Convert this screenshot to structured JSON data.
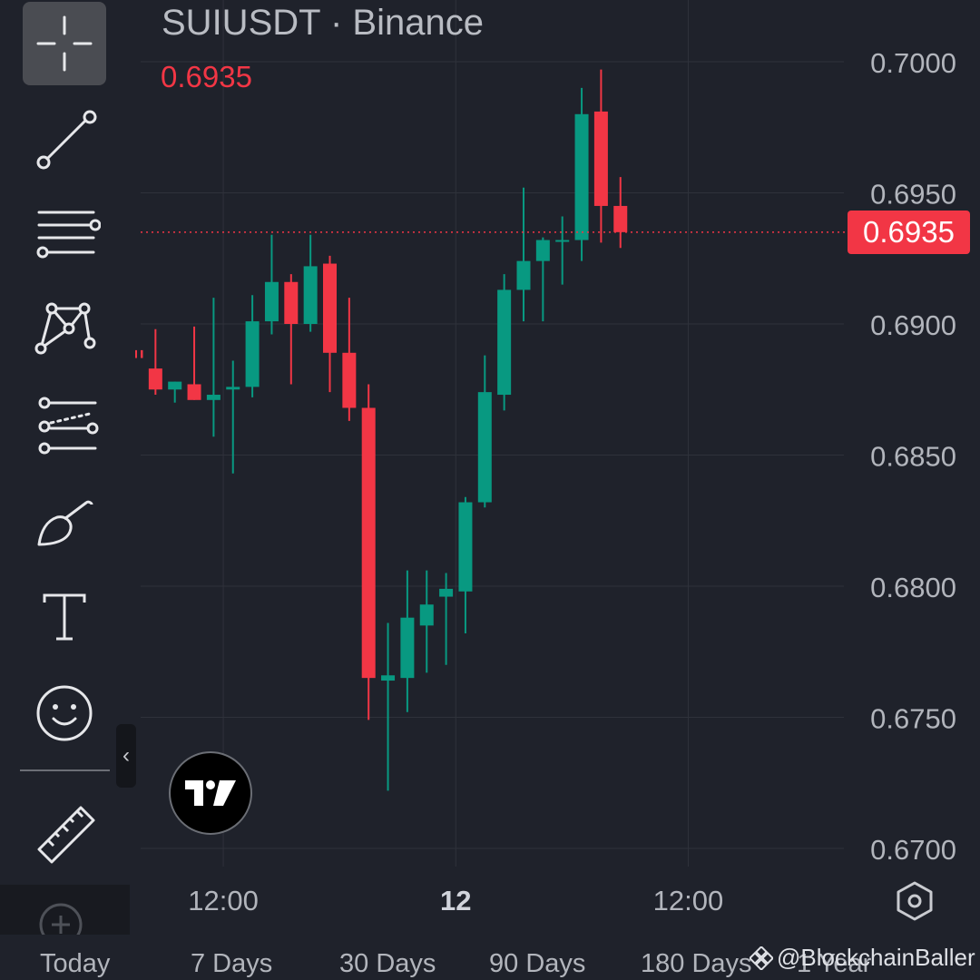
{
  "header": {
    "symbol_title": "SUIUSDT · Binance",
    "current_price": "0.6935"
  },
  "price_badge": "0.6935",
  "toolbar": {
    "tools": [
      {
        "name": "crosshair-icon",
        "active": true
      },
      {
        "name": "trend-line-icon"
      },
      {
        "name": "horizontal-lines-icon"
      },
      {
        "name": "pattern-icon"
      },
      {
        "name": "fib-retracement-icon"
      },
      {
        "name": "brush-icon"
      },
      {
        "name": "text-icon"
      },
      {
        "name": "emoji-icon"
      },
      {
        "name": "ruler-icon"
      },
      {
        "name": "add-icon"
      }
    ],
    "collapse_glyph": "‹"
  },
  "range_bar": [
    "Today",
    "7 Days",
    "30 Days",
    "90 Days",
    "180 Days",
    "1 Year"
  ],
  "watermark": "@BlockchainBaller",
  "colors": {
    "up": "#089981",
    "down": "#f23645",
    "background": "#1f222b",
    "grid": "#2f323b",
    "axis_text": "#b2b5bc"
  },
  "chart_data": {
    "type": "candlestick",
    "symbol": "SUIUSDT",
    "exchange": "Binance",
    "last_price": 0.6935,
    "y_ticks": [
      0.7,
      0.695,
      0.69,
      0.685,
      0.68,
      0.675,
      0.67
    ],
    "y_tick_labels": [
      "0.7000",
      "0.6950",
      "0.6900",
      "0.6850",
      "0.6800",
      "0.6750",
      "0.6700"
    ],
    "ylim": [
      0.6688,
      0.7018
    ],
    "x_ticks": [
      {
        "label": "12:00",
        "index": 4.5,
        "bold": false
      },
      {
        "label": "12",
        "index": 16.5,
        "bold": true
      },
      {
        "label": "12:00",
        "index": 28.5,
        "bold": false
      }
    ],
    "grid": true,
    "candles": [
      {
        "o": 0.689,
        "h": 0.689,
        "c": 0.6887,
        "l": 0.6887
      },
      {
        "o": 0.6883,
        "h": 0.6898,
        "c": 0.6875,
        "l": 0.6873
      },
      {
        "o": 0.6875,
        "h": 0.6878,
        "c": 0.6878,
        "l": 0.687
      },
      {
        "o": 0.6877,
        "h": 0.6899,
        "c": 0.6871,
        "l": 0.6871
      },
      {
        "o": 0.6871,
        "h": 0.691,
        "c": 0.6873,
        "l": 0.6857
      },
      {
        "o": 0.6875,
        "h": 0.6886,
        "c": 0.6876,
        "l": 0.6843
      },
      {
        "o": 0.6876,
        "h": 0.6911,
        "c": 0.6901,
        "l": 0.6872
      },
      {
        "o": 0.6901,
        "h": 0.6934,
        "c": 0.6916,
        "l": 0.6896
      },
      {
        "o": 0.6916,
        "h": 0.6919,
        "c": 0.69,
        "l": 0.6877
      },
      {
        "o": 0.69,
        "h": 0.6934,
        "c": 0.6922,
        "l": 0.6897
      },
      {
        "o": 0.6923,
        "h": 0.6926,
        "c": 0.6889,
        "l": 0.6874
      },
      {
        "o": 0.6889,
        "h": 0.691,
        "c": 0.6868,
        "l": 0.6863
      },
      {
        "o": 0.6868,
        "h": 0.6877,
        "c": 0.6765,
        "l": 0.6749
      },
      {
        "o": 0.6764,
        "h": 0.6786,
        "c": 0.6766,
        "l": 0.6722
      },
      {
        "o": 0.6765,
        "h": 0.6806,
        "c": 0.6788,
        "l": 0.6752
      },
      {
        "o": 0.6785,
        "h": 0.6806,
        "c": 0.6793,
        "l": 0.6767
      },
      {
        "o": 0.6796,
        "h": 0.6805,
        "c": 0.6799,
        "l": 0.677
      },
      {
        "o": 0.6798,
        "h": 0.6834,
        "c": 0.6832,
        "l": 0.6782
      },
      {
        "o": 0.6832,
        "h": 0.6888,
        "c": 0.6874,
        "l": 0.683
      },
      {
        "o": 0.6873,
        "h": 0.6919,
        "c": 0.6913,
        "l": 0.6867
      },
      {
        "o": 0.6913,
        "h": 0.6952,
        "c": 0.6924,
        "l": 0.6901
      },
      {
        "o": 0.6924,
        "h": 0.6933,
        "c": 0.6932,
        "l": 0.6901
      },
      {
        "o": 0.6932,
        "h": 0.6941,
        "c": 0.6932,
        "l": 0.6915
      },
      {
        "o": 0.6932,
        "h": 0.699,
        "c": 0.698,
        "l": 0.6924
      },
      {
        "o": 0.6981,
        "h": 0.6997,
        "c": 0.6945,
        "l": 0.6931
      },
      {
        "o": 0.6945,
        "h": 0.6956,
        "c": 0.6935,
        "l": 0.6929
      }
    ]
  }
}
